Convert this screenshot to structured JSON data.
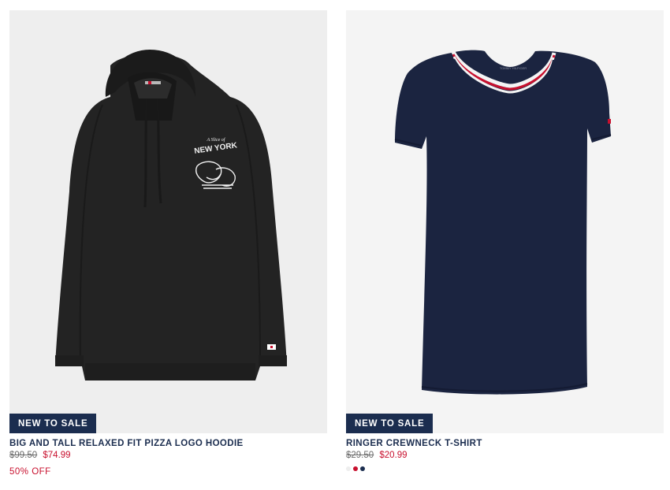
{
  "products": [
    {
      "badge": "NEW TO SALE",
      "name": "BIG AND TALL RELAXED FIT PIZZA LOGO HOODIE",
      "old_price": "$99.50",
      "new_price": "$74.99",
      "promo": "50% OFF",
      "image_icon": "hoodie-photo",
      "print_text": "NEW YORK"
    },
    {
      "badge": "NEW TO SALE",
      "name": "RINGER CREWNECK T-SHIRT",
      "old_price": "$29.50",
      "new_price": "$20.99",
      "image_icon": "tshirt-photo",
      "swatches": [
        "#eeeeee",
        "#c8102e",
        "#1b2d4f"
      ]
    }
  ],
  "colors": {
    "navy": "#1b2d4f",
    "sale_red": "#c8102e"
  }
}
